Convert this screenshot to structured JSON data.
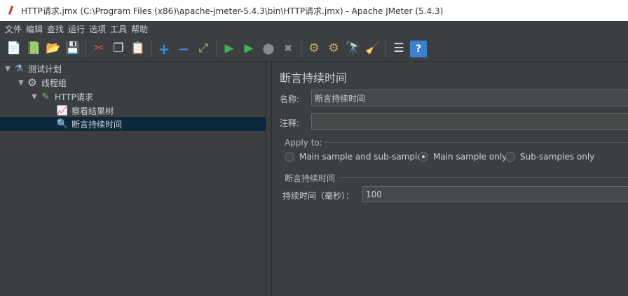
{
  "window": {
    "title": "HTTP请求.jmx (C:\\Program Files (x86)\\apache-jmeter-5.4.3\\bin\\HTTP请求.jmx) - Apache JMeter (5.4.3)"
  },
  "menu": {
    "items": [
      "文件",
      "编辑",
      "查找",
      "运行",
      "选项",
      "工具",
      "帮助"
    ]
  },
  "toolbar": {
    "buttons": [
      {
        "name": "new-icon",
        "glyph": "📄",
        "color": "#e8e8e8"
      },
      {
        "name": "templates-icon",
        "glyph": "📗",
        "color": "#4aa36b"
      },
      {
        "name": "open-icon",
        "glyph": "📂",
        "color": "#e0a630"
      },
      {
        "name": "save-icon",
        "glyph": "💾",
        "color": "#9aa0a6"
      },
      {
        "name": "cut-icon",
        "glyph": "✂",
        "color": "#e24b4b"
      },
      {
        "name": "copy-icon",
        "glyph": "❐",
        "color": "#e8e8e8"
      },
      {
        "name": "paste-icon",
        "glyph": "📋",
        "color": "#c9a055"
      },
      {
        "name": "expand-icon",
        "glyph": "+",
        "color": "#3d8fe0"
      },
      {
        "name": "collapse-icon",
        "glyph": "−",
        "color": "#3d8fe0"
      },
      {
        "name": "toggle-icon",
        "glyph": "⤢",
        "color": "#9bc46a"
      },
      {
        "name": "start-icon",
        "glyph": "▶",
        "color": "#3fb34f"
      },
      {
        "name": "start-no-pauses-icon",
        "glyph": "▶",
        "color": "#3fb34f"
      },
      {
        "name": "stop-icon",
        "glyph": "⬤",
        "color": "#8a8a8a"
      },
      {
        "name": "shutdown-icon",
        "glyph": "✖",
        "color": "#8a8a8a"
      },
      {
        "name": "clear-icon",
        "glyph": "⚙",
        "color": "#c4a96b"
      },
      {
        "name": "clear-all-icon",
        "glyph": "⚙",
        "color": "#c4a96b"
      },
      {
        "name": "search-icon",
        "glyph": "🔭",
        "color": "#9aa0a6"
      },
      {
        "name": "reset-search-icon",
        "glyph": "🧹",
        "color": "#e7c02d"
      },
      {
        "name": "function-helper-icon",
        "glyph": "☰",
        "color": "#e8e8e8"
      },
      {
        "name": "help-icon",
        "glyph": "?",
        "color": "#ffffff"
      }
    ]
  },
  "tree": {
    "test_plan": "测试计划",
    "thread_group": "线程组",
    "http_request": "HTTP请求",
    "view_results_tree": "察看结果树",
    "duration_assertion": "断言持续时间"
  },
  "panel": {
    "title": "断言持续时间",
    "name_label": "名称:",
    "name_value": "断言持续时间",
    "comment_label": "注释:",
    "comment_value": "",
    "apply_to_title": "Apply to:",
    "apply_options": [
      {
        "label": "Main sample and sub-samples",
        "checked": false
      },
      {
        "label": "Main sample only",
        "checked": true
      },
      {
        "label": "Sub-samples only",
        "checked": false
      }
    ],
    "section_title": "断言持续时间",
    "duration_label": "持续时间（毫秒）：",
    "duration_value": "100"
  }
}
